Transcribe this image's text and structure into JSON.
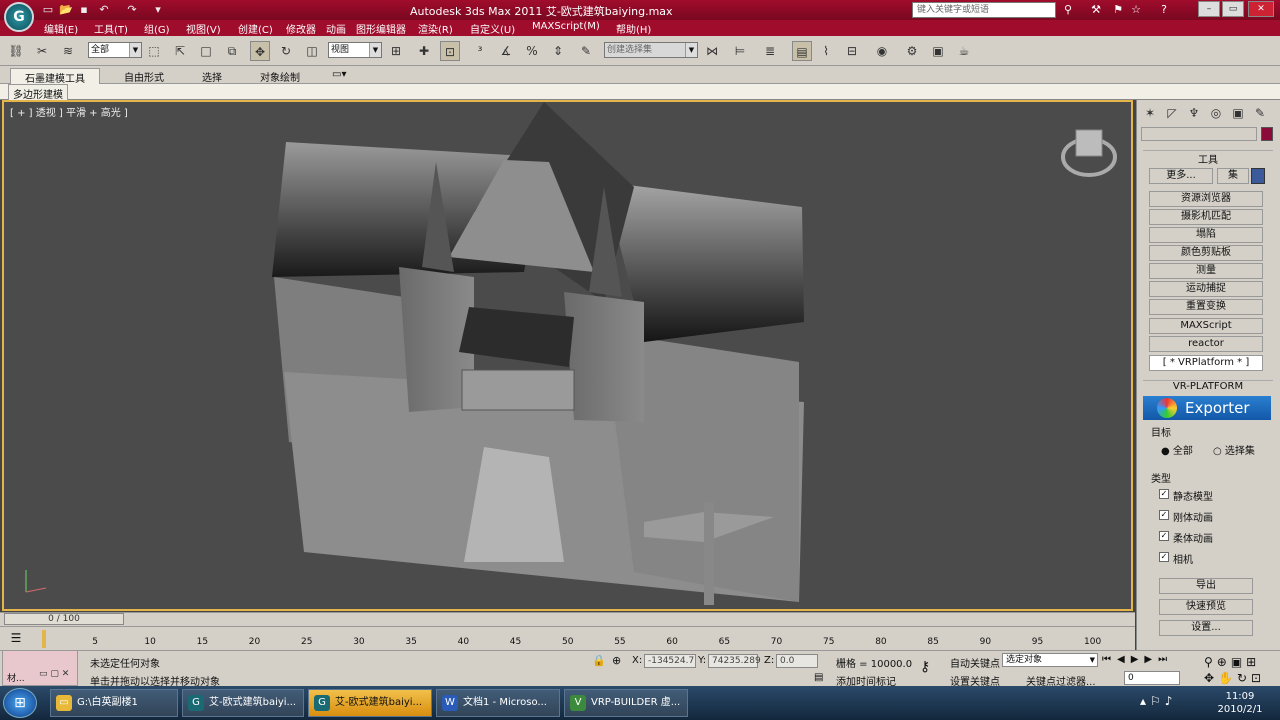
{
  "app": {
    "title": "Autodesk 3ds Max  2011     艾-欧式建筑baiying.max",
    "search_placeholder": "键入关键字或短语",
    "logo": "3ds-max-logo"
  },
  "menu": [
    "编辑(E)",
    "工具(T)",
    "组(G)",
    "视图(V)",
    "创建(C)",
    "修改器",
    "动画",
    "图形编辑器",
    "渲染(R)",
    "自定义(U)",
    "MAXScript(M)",
    "帮助(H)"
  ],
  "toolbar": {
    "selection_filter": "全部",
    "reference_coord": "视图",
    "named_selection": "创建选择集"
  },
  "ribbon": {
    "tabs": [
      "石墨建模工具",
      "自由形式",
      "选择",
      "对象绘制"
    ],
    "sub_tab": "多边形建模"
  },
  "viewport": {
    "label": "[ + ] 透视 ] 平滑 + 高光 ]"
  },
  "command_panel": {
    "utilities_title": "工具",
    "more_button": "更多...",
    "sets_button": "集",
    "utility_buttons": [
      "资源浏览器",
      "摄影机匹配",
      "塌陷",
      "颜色剪贴板",
      "测量",
      "运动捕捉",
      "重置变换",
      "MAXScript",
      "reactor",
      "[ * VRPlatform * ]"
    ],
    "vr_title": "VR-PLATFORM",
    "exporter_label": "Exporter",
    "target_label": "目标",
    "target_options": [
      "全部",
      "选择集"
    ],
    "type_label": "类型",
    "type_options": [
      "静态模型",
      "刚体动画",
      "柔体动画",
      "相机"
    ],
    "export_button": "导出",
    "quick_preview_button": "快速预览",
    "settings_button": "设置..."
  },
  "timeline": {
    "frame_counter": "0 / 100",
    "ticks": [
      "0",
      "5",
      "10",
      "15",
      "20",
      "25",
      "30",
      "35",
      "40",
      "45",
      "50",
      "55",
      "60",
      "65",
      "70",
      "75",
      "80",
      "85",
      "90",
      "95",
      "100"
    ]
  },
  "status": {
    "selection_text": "未选定任何对象",
    "prompt_text": "单击并拖动以选择并移动对象",
    "x_label": "X:",
    "x_value": "-134524.7",
    "y_label": "Y:",
    "y_value": "74235.289",
    "z_label": "Z:",
    "z_value": "0.0",
    "grid_text": "栅格 = 10000.0",
    "add_time_tag": "添加时间标记",
    "auto_key": "自动关键点",
    "set_key": "设置关键点",
    "key_target": "选定对象",
    "key_filters": "关键点过滤器...",
    "current_frame": "0",
    "float_title": "材..."
  },
  "taskbar": {
    "tasks": [
      "G:\\白英副楼1",
      "艾-欧式建筑baiyi...",
      "艾-欧式建筑baiyi...",
      "文档1 - Microso...",
      "VRP-BUILDER 虚..."
    ],
    "time": "11:09",
    "date": "2010/2/1"
  }
}
